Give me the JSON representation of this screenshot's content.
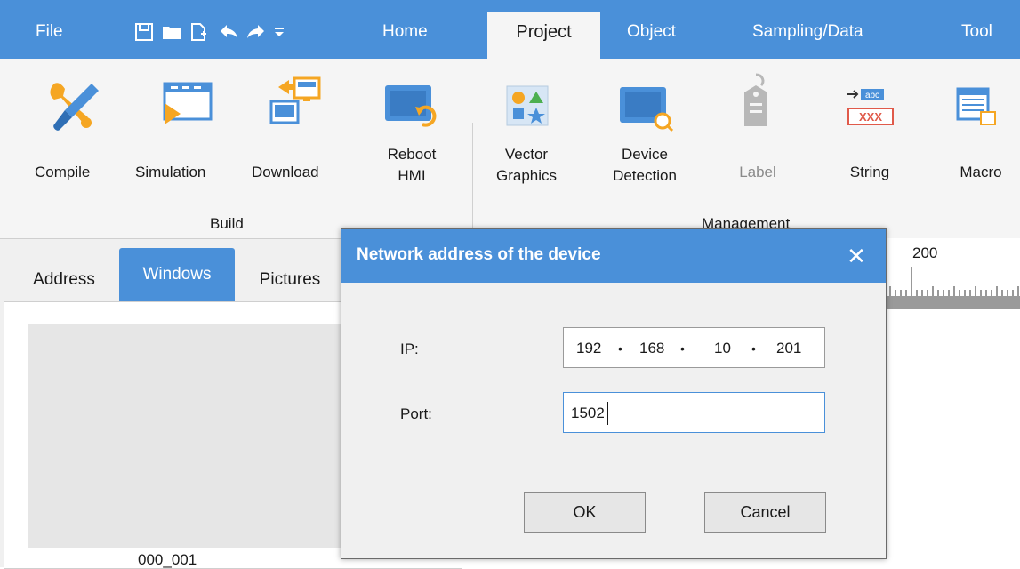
{
  "menubar": {
    "file": "File",
    "home": "Home",
    "project": "Project",
    "object": "Object",
    "sampling": "Sampling/Data",
    "tool": "Tool",
    "quick_access_icons": [
      "save-icon",
      "open-folder-icon",
      "new-file-icon",
      "undo-icon",
      "redo-icon",
      "customize-dropdown-icon"
    ]
  },
  "ribbon": {
    "build": {
      "group_label": "Build",
      "compile": "Compile",
      "simulation": "Simulation",
      "download": "Download",
      "reboot_line1": "Reboot",
      "reboot_line2": "HMI"
    },
    "management": {
      "group_label": "Management",
      "vector_line1": "Vector",
      "vector_line2": "Graphics",
      "device_line1": "Device",
      "device_line2": "Detection",
      "label": "Label",
      "string": "String",
      "macro": "Macro"
    },
    "colors": {
      "accent": "#4a90d9",
      "ribbon_bg": "#f5f5f5",
      "disabled_text": "#8a8a8a"
    }
  },
  "left_panel": {
    "tabs": [
      "Address",
      "Windows",
      "Pictures"
    ],
    "active_tab": "Windows",
    "window_thumb_label": "000_001"
  },
  "ruler": {
    "tick_label": "200"
  },
  "dialog": {
    "title": "Network address of the device",
    "ip_label": "IP:",
    "ip_parts": [
      "192",
      "168",
      "10",
      "201"
    ],
    "port_label": "Port:",
    "port_value": "1502",
    "ok_label": "OK",
    "cancel_label": "Cancel"
  }
}
